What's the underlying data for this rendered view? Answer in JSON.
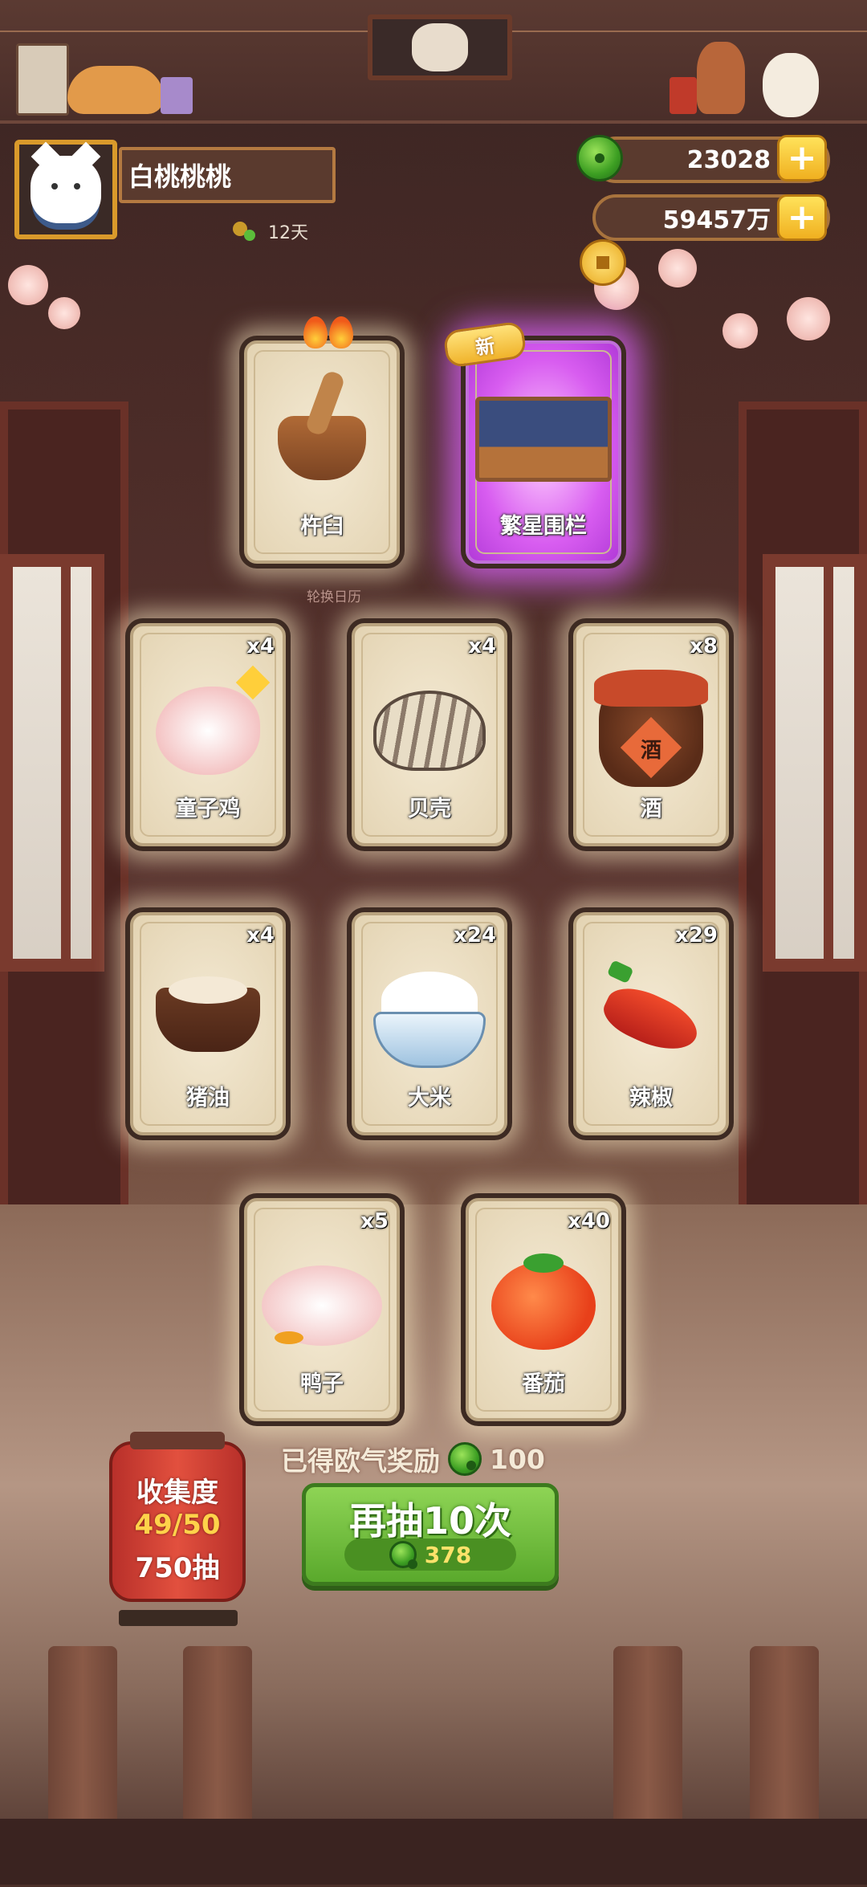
{
  "player": {
    "name": "白桃桃桃",
    "days": "12天"
  },
  "currency": {
    "jade": "23028",
    "coins": "59457万"
  },
  "caption": "轮换日历",
  "cards": [
    {
      "name": "杵臼",
      "count": "",
      "flames": true
    },
    {
      "name": "繁星围栏",
      "count": "",
      "badge": "新"
    },
    {
      "name": "童子鸡",
      "count": "x4"
    },
    {
      "name": "贝壳",
      "count": "x4"
    },
    {
      "name": "酒",
      "count": "x8",
      "jar_label": "酒"
    },
    {
      "name": "猪油",
      "count": "x4"
    },
    {
      "name": "大米",
      "count": "x24"
    },
    {
      "name": "辣椒",
      "count": "x29"
    },
    {
      "name": "鸭子",
      "count": "x5"
    },
    {
      "name": "番茄",
      "count": "x40"
    }
  ],
  "reward": {
    "label": "已得欧气奖励",
    "amount": "100"
  },
  "redraw": {
    "label": "再抽10次",
    "cost": "378"
  },
  "collection": {
    "title": "收集度",
    "progress": "49/50",
    "draws": "750抽"
  },
  "colors": {
    "accent_gold": "#d99a2b",
    "button_green": "#6ab83a",
    "lantern_red": "#d2453a",
    "highlight_purple": "#d85df0"
  }
}
